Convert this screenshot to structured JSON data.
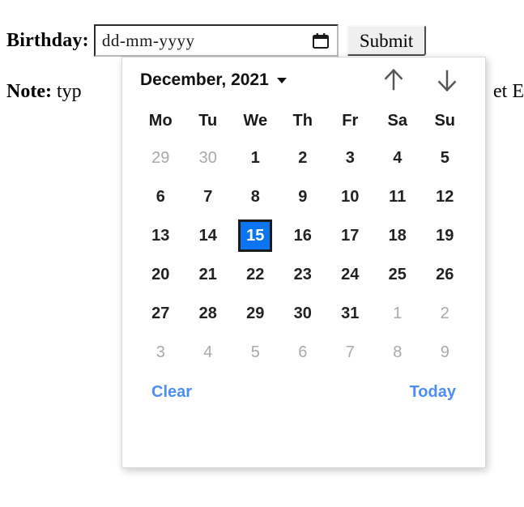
{
  "form": {
    "label": "Birthday:",
    "date_placeholder": "dd-mm-yyyy",
    "date_value": "",
    "calendar_icon": "calendar-icon",
    "submit_label": "Submit"
  },
  "note": {
    "prefix": "Note:",
    "text_before_overlap": " typ",
    "text_after_overlap": "et E"
  },
  "datepicker": {
    "title": "December, 2021",
    "caret_icon": "chevron-down-icon",
    "prev_icon": "arrow-up-icon",
    "next_icon": "arrow-down-icon",
    "weekdays": [
      "Mo",
      "Tu",
      "We",
      "Th",
      "Fr",
      "Sa",
      "Su"
    ],
    "selected_day": 15,
    "weeks": [
      [
        {
          "label": "29",
          "muted": true
        },
        {
          "label": "30",
          "muted": true
        },
        {
          "label": "1",
          "muted": false
        },
        {
          "label": "2",
          "muted": false
        },
        {
          "label": "3",
          "muted": false
        },
        {
          "label": "4",
          "muted": false
        },
        {
          "label": "5",
          "muted": false
        }
      ],
      [
        {
          "label": "6",
          "muted": false
        },
        {
          "label": "7",
          "muted": false
        },
        {
          "label": "8",
          "muted": false
        },
        {
          "label": "9",
          "muted": false
        },
        {
          "label": "10",
          "muted": false
        },
        {
          "label": "11",
          "muted": false
        },
        {
          "label": "12",
          "muted": false
        }
      ],
      [
        {
          "label": "13",
          "muted": false
        },
        {
          "label": "14",
          "muted": false
        },
        {
          "label": "15",
          "muted": false,
          "selected": true
        },
        {
          "label": "16",
          "muted": false
        },
        {
          "label": "17",
          "muted": false
        },
        {
          "label": "18",
          "muted": false
        },
        {
          "label": "19",
          "muted": false
        }
      ],
      [
        {
          "label": "20",
          "muted": false
        },
        {
          "label": "21",
          "muted": false
        },
        {
          "label": "22",
          "muted": false
        },
        {
          "label": "23",
          "muted": false
        },
        {
          "label": "24",
          "muted": false
        },
        {
          "label": "25",
          "muted": false
        },
        {
          "label": "26",
          "muted": false
        }
      ],
      [
        {
          "label": "27",
          "muted": false
        },
        {
          "label": "28",
          "muted": false
        },
        {
          "label": "29",
          "muted": false
        },
        {
          "label": "30",
          "muted": false
        },
        {
          "label": "31",
          "muted": false
        },
        {
          "label": "1",
          "muted": true
        },
        {
          "label": "2",
          "muted": true
        }
      ],
      [
        {
          "label": "3",
          "muted": true
        },
        {
          "label": "4",
          "muted": true
        },
        {
          "label": "5",
          "muted": true
        },
        {
          "label": "6",
          "muted": true
        },
        {
          "label": "7",
          "muted": true
        },
        {
          "label": "8",
          "muted": true
        },
        {
          "label": "9",
          "muted": true
        }
      ]
    ],
    "clear_label": "Clear",
    "today_label": "Today"
  },
  "colors": {
    "selected_day_bg": "#0b74f0",
    "selected_day_border": "#1b1b1b",
    "link": "#4c8ef5",
    "muted_day": "#a9a9a9",
    "panel_bg": "#ffffff"
  }
}
